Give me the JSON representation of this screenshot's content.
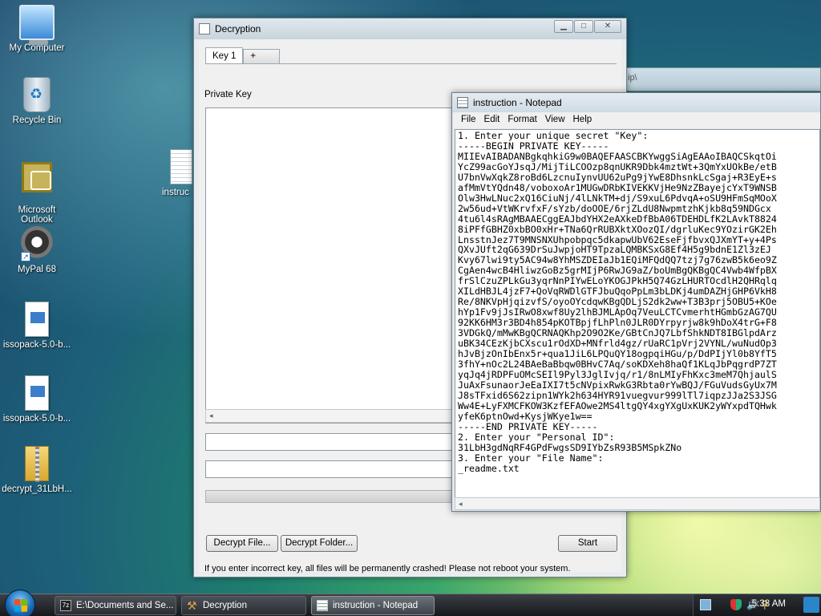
{
  "desktop": {
    "icons": [
      {
        "label": "My Computer",
        "icon": "computer-icon"
      },
      {
        "label": "Recycle Bin",
        "icon": "recycle-bin-icon"
      },
      {
        "label": "Microsoft\nOutlook",
        "icon": "outlook-icon"
      },
      {
        "label": "MyPal 68",
        "icon": "mypal-icon"
      },
      {
        "label": "issopack-5.0-b...",
        "icon": "installer-icon"
      },
      {
        "label": "issopack-5.0-b...",
        "icon": "installer-icon"
      },
      {
        "label": "decrypt_31LbH...",
        "icon": "zip-archive-icon"
      },
      {
        "label": "instruc",
        "icon": "text-file-icon"
      }
    ]
  },
  "decryption_window": {
    "title": "Decryption",
    "tabs": [
      {
        "label": "Key 1"
      },
      {
        "label": "+"
      }
    ],
    "private_key_label": "Private Key",
    "private_key_value": "",
    "field1_value": "",
    "field2_value": "",
    "buttons": {
      "decrypt_file": "Decrypt File...",
      "decrypt_folder": "Decrypt Folder...",
      "start": "Start"
    },
    "warning": "If you enter incorrect key, all files will be permanently crashed! Please not reboot your system."
  },
  "explorer_hint": {
    "text": "ip\\"
  },
  "notepad_window": {
    "title": "instruction - Notepad",
    "menu": [
      "File",
      "Edit",
      "Format",
      "View",
      "Help"
    ],
    "lines": [
      "1. Enter your unique secret \"Key\":",
      "-----BEGIN PRIVATE KEY-----",
      "MIIEvAIBADANBgkqhkiG9w0BAQEFAASCBKYwggSiAgEAAoIBAQCSkqtOi",
      "YcZ99acGoYJsqJ/MijTiLCOOzp8qnUKR9Dbk4mztWt+3QmYxUOkBe/etB",
      "U7bnVwXqkZ8roBd6LzcnuIynvUU62uPg9jYwE8DhsnkLcSgaj+R3EyE+s",
      "afMmVtYQdn48/voboxoAr1MUGwDRbKIVEKKVjHe9NzZBayejcYxT9WNSB",
      "Olw3HwLNuc2xQ16CiuNj/4lLNkTM+dj/S9xuL6PdvqA+oSU9HFmSqMOoX",
      "2w56ud+VtWKrvfxF/sYzb/doOOE/6rjZLdU8NwpmtzhKjkb8q59NDGcx",
      "4tu6l4sRAgMBAAECggEAJbdYHX2eAXkeDfBbA06TDEHDLfK2LAvkT8824",
      "8iPFfGBHZ0xbBO0xHr+TNa6QrRUBXktXOozQI/dgrluKec9YOzirGK2Eh",
      "LnsstnJez7T9MNSNXUhpobpqc5dkapwUbV62EseFjfbvxQJXmYT+y+4Ps",
      "QXvJUft2qG639DrSuJwpjoHT9TpzaLQMBKSxG8Ef4H5g9bdnE1Zl3zEJ",
      "Kvy67lwi9ty5AC94w8YhMSZDEIaJb1EQiMFQdQQ7tzj7g76zwB5k6eo9Z",
      "CgAen4wcB4HliwzGoBz5grMIjP6RwJG9aZ/boUmBgQKBgQC4Vwb4WfpBX",
      "frSlCzuZPLkGu3yqrNnPIYwELoYKOGJPkH5Q74GzLHURTOcdlH2QHRqlq",
      "XILdHBJL4jzF7+QoVqRWDlGTFJbuQqoPpLm3bLDKj4umDAZHjGHP6VkH8",
      "Re/8NKVpHjqizvfS/oyoOYcdqwKBgQDLjS2dk2ww+T3B3prj5OBU5+KOe",
      "hYp1Fv9jJsIRwO8xwf8Uy2lhBJMLApOq7VeuLCTCvmerhtHGmbGzAG7QU",
      "92KK6HM3r3BD4h854pKOTBpjfLhPln0JLR0DYrpyrjw8k9hDoX4trG+F8",
      "3VDGkQ/mMwKBgQCRNAQKhp2O9O2Ke/GBtCnJQ7LbfShkNDT8IBGlpdArz",
      "uBK34CEzKjbCXscu1rOdXD+MNfrld4gz/rUaRC1pVrj2VYNL/wuNudOp3",
      "hJvBjzOnIbEnx5r+qua1JiL6LPQuQY18ogpqiHGu/p/DdPIjYl0b8YfT5",
      "3fhY+nOc2L24BAeBaBbqw0BHvC7Aq/soKDXeh8haQf1KLqJbPqgrdP7ZT",
      "yqJq4jRDPFuOMcSEIl9Pyl3JglIvjq/r1/8nLMIyFhKxc3meM7QhjaulS",
      "JuAxFsunaorJeEaIXI7t5cNVpixRwkG3Rbta0rYwBQJ/FGuVudsGyUx7M",
      "J8sTFxid6S62zipn1WYk2h634HYR91vuegvur999lTl7iqpzJJa2S3JSG",
      "Ww4E+LyFXMCFKOW3KzfEFAOwe2MS4ltgQY4xgYXgUxKUK2yWYxpdTQHwk",
      "yfeK6ptnOwd+KysjWKye1w==",
      "-----END PRIVATE KEY-----",
      "",
      "2. Enter your \"Personal ID\":",
      "31LbH3gdNqRF4GPdFwgsSD9IYbZsR93B5MSpkZNo",
      "",
      "3. Enter your \"File Name\":",
      "_readme.txt"
    ]
  },
  "taskbar": {
    "tasks": [
      {
        "label": "E:\\Documents and Se...",
        "icon": "7zip-icon"
      },
      {
        "label": "Decryption",
        "icon": "hammer-icon"
      },
      {
        "label": "instruction - Notepad",
        "icon": "notepad-icon"
      }
    ],
    "clock": "5:38 AM"
  }
}
